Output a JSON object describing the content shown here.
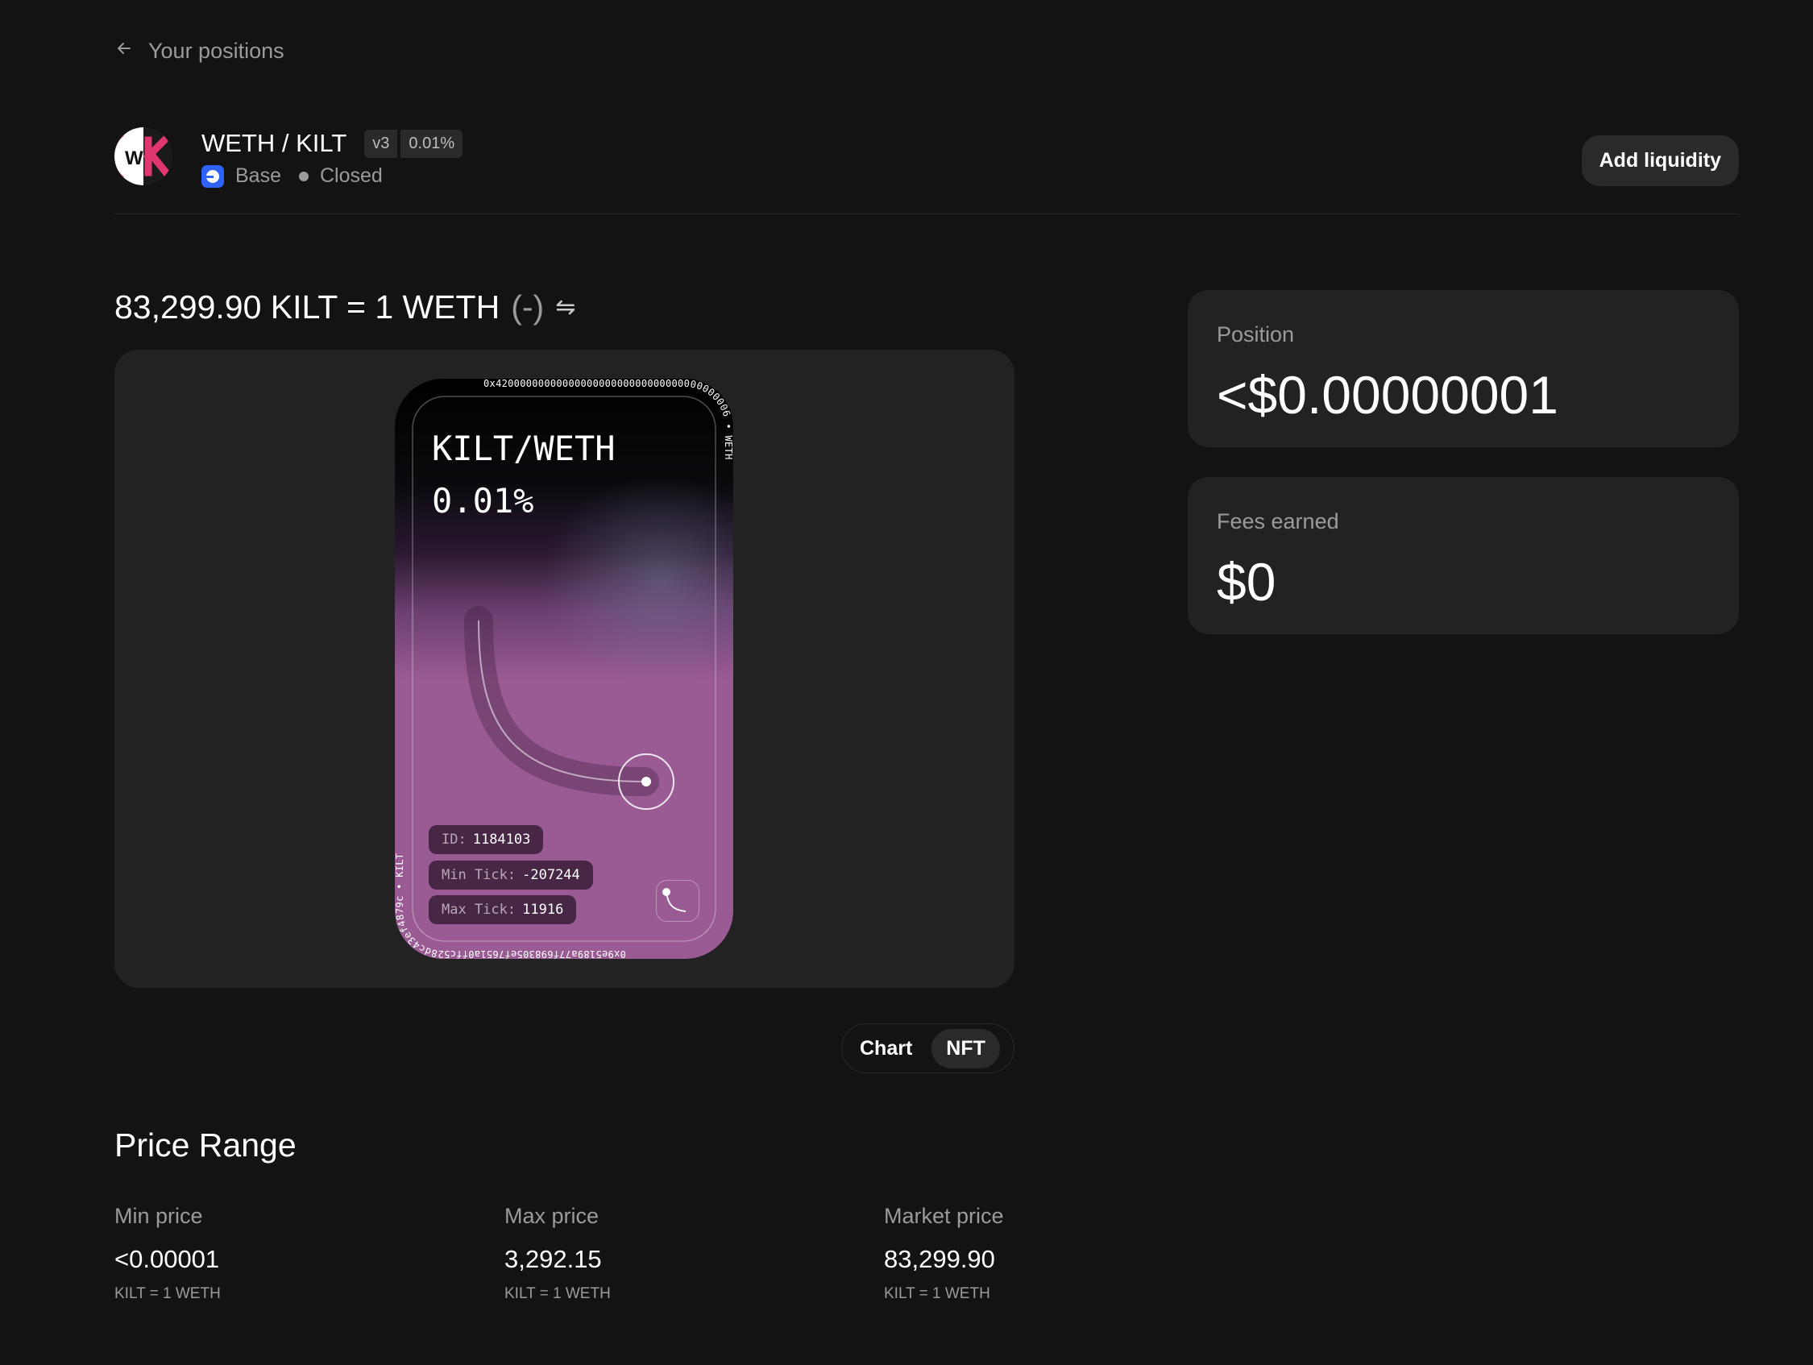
{
  "nav": {
    "back_label": "Your positions"
  },
  "pool": {
    "logo_text": "W",
    "title": "WETH / KILT",
    "version": "v3",
    "fee": "0.01%",
    "chain": "Base",
    "status": "Closed",
    "add_liquidity_label": "Add liquidity"
  },
  "price": {
    "text": "83,299.90 KILT = 1 WETH",
    "change": "(-)",
    "swap_glyph": "⇋"
  },
  "nft": {
    "title_line1": "KILT/WETH",
    "title_line2": "0.01%",
    "top_address": "0x4200000000000000000000000000000000000006",
    "top_symbol": "WETH",
    "bottom_address": "0x9e5189a77f698305ef7651a0ffc528dc43ef4879c",
    "bottom_symbol": "KILT",
    "id_label": "ID:",
    "id_value": "1184103",
    "min_tick_label": "Min Tick:",
    "min_tick_value": "-207244",
    "max_tick_label": "Max Tick:",
    "max_tick_value": "11916"
  },
  "view_toggle": {
    "chart_label": "Chart",
    "nft_label": "NFT",
    "active": "NFT"
  },
  "price_range": {
    "title": "Price Range",
    "min": {
      "label": "Min price",
      "value": "<0.00001",
      "unit": "KILT = 1 WETH"
    },
    "max": {
      "label": "Max price",
      "value": "3,292.15",
      "unit": "KILT = 1 WETH"
    },
    "market": {
      "label": "Market price",
      "value": "83,299.90",
      "unit": "KILT = 1 WETH"
    }
  },
  "position": {
    "label": "Position",
    "value": "<$0.00000001"
  },
  "fees": {
    "label": "Fees earned",
    "value": "$0"
  },
  "colors": {
    "background": "#131313",
    "surface": "#222222",
    "chain_blue": "#2f62f6",
    "logo_pink": "#e0376f",
    "nft_purple": "#9a5b94"
  }
}
